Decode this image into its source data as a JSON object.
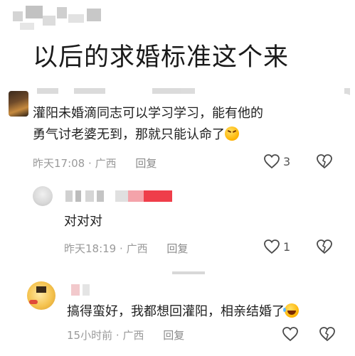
{
  "post": {
    "title": "以后的求婚标准这个来"
  },
  "comments": [
    {
      "text_line1": "灌阳未婚滴同志可以学习学习，能有他的",
      "text_line2": "勇气讨老婆无到，那就只能认命了",
      "emoji": "crossed-eyes-emoji",
      "time": "昨天17:08",
      "location": "广西",
      "reply_label": "回复",
      "like_count": "3"
    }
  ],
  "replies": [
    {
      "text": "对对对",
      "time": "昨天18:19",
      "location": "广西",
      "reply_label": "回复",
      "like_count": "1"
    },
    {
      "text": "搞得蛮好，我都想回灌阳，相亲结婚了",
      "emoji": "laughing-tears-emoji",
      "time": "15小时前",
      "location": "广西",
      "reply_label": "回复",
      "like_count": ""
    }
  ],
  "separator": "·",
  "icons": {
    "like": "heart-outline-icon",
    "dislike": "broken-heart-icon"
  },
  "colors": {
    "text": "#1f1f1f",
    "meta": "#9a9a9a",
    "username_redacted_pink": "#f4a3aa",
    "username_redacted_red": "#ef3e4a"
  }
}
